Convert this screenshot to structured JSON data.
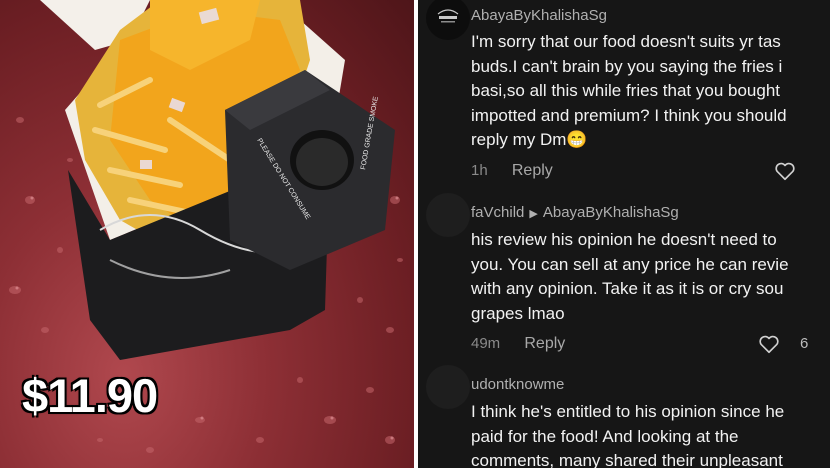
{
  "photo": {
    "price_label": "$11.90",
    "box_text_1": "PLEASE DO NOT CONSUME",
    "box_text_2": "FOOD GRADE SMOKE"
  },
  "comments": [
    {
      "username": "AbayaByKhalishaSg",
      "text": "I'm sorry that our food doesn't suits yr tas\nbuds.I can't brain by you saying the fries i\nbasi,so all this while fries that you bought\nimpotted and premium? I think you should\nreply my Dm😁",
      "time": "1h",
      "reply_label": "Reply",
      "likes": ""
    },
    {
      "username": "faVchild",
      "reply_to": "AbayaByKhalishaSg",
      "text": "his review his opinion he doesn't need to\nyou. You can sell at any price he can revie\nwith any opinion. Take it as it is or cry sou\ngrapes lmao",
      "time": "49m",
      "reply_label": "Reply",
      "likes": "6"
    },
    {
      "username": "udontknowme",
      "text": "I think he's entitled to his opinion since he\npaid for the food! And looking at the\ncomments, many shared their unpleasant",
      "time": "",
      "reply_label": "",
      "likes": ""
    }
  ],
  "colors": {
    "panel_bg": "#161616",
    "username": "#b0b0b0",
    "body_text": "#f2f2f2",
    "table_red": "#8d2f35",
    "cheese": "#f2a51c"
  },
  "icons": [
    "heart-icon",
    "reply-arrow-icon",
    "brand-logo"
  ]
}
